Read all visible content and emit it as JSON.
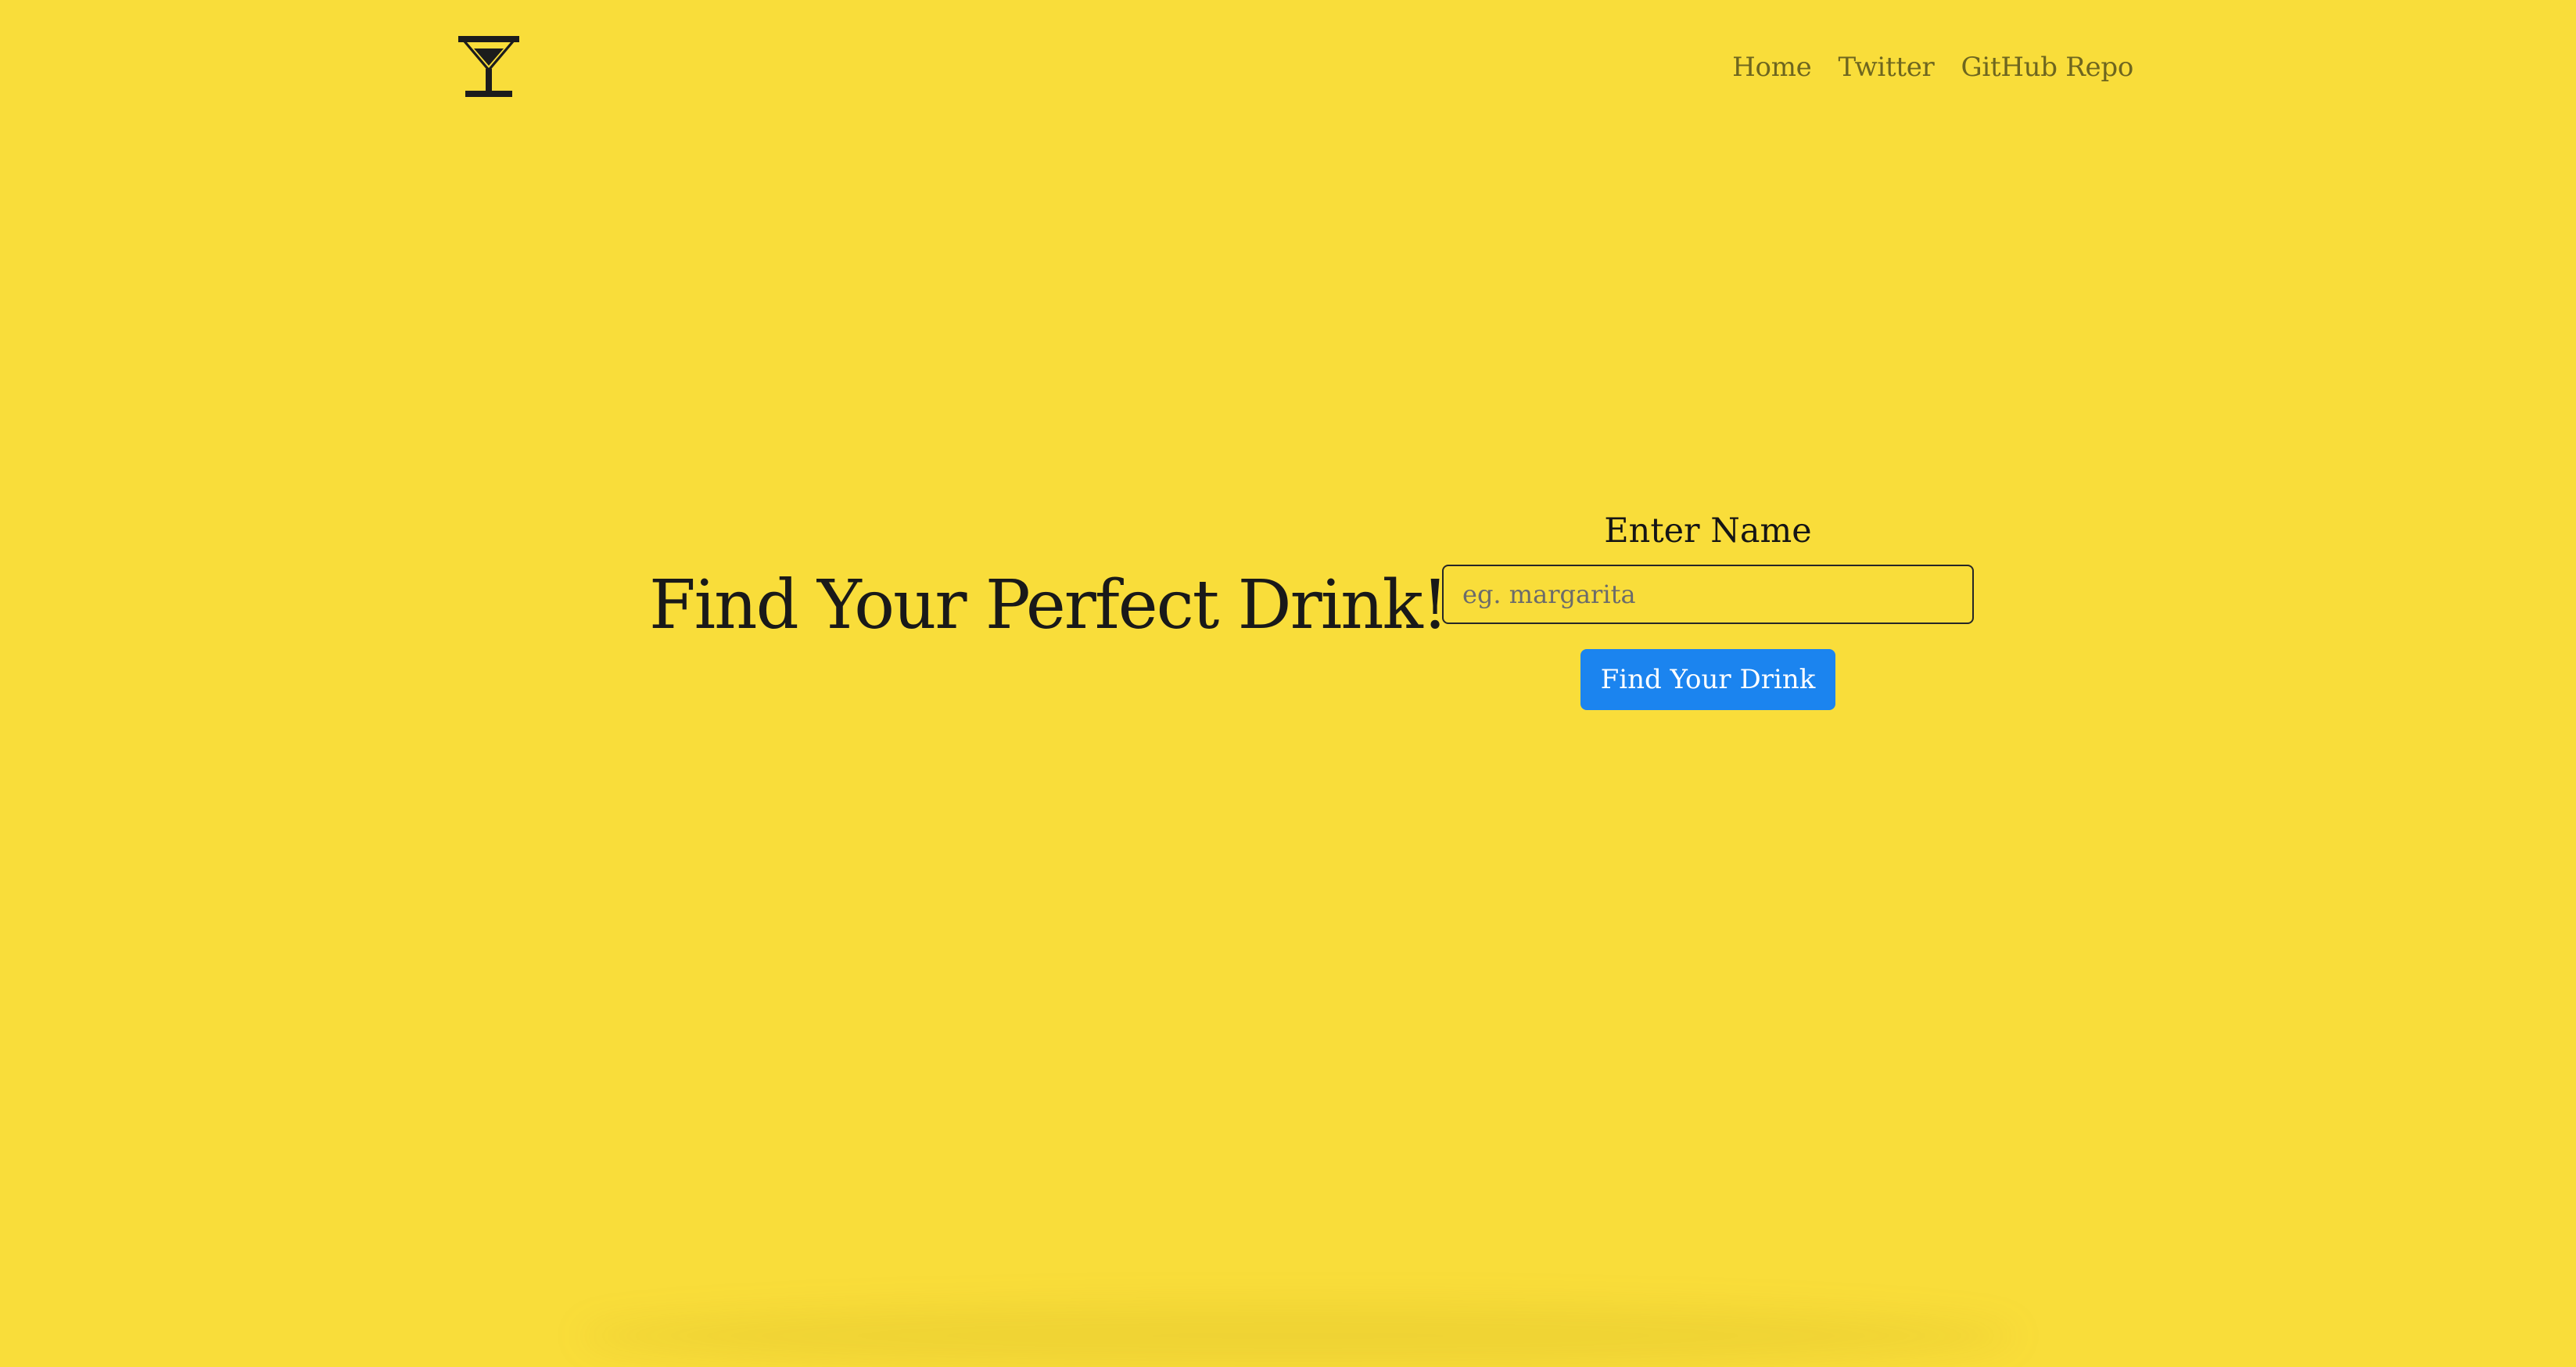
{
  "brand": {
    "logo_icon": "cocktail-glass-icon"
  },
  "nav": {
    "links": [
      {
        "label": "Home"
      },
      {
        "label": "Twitter"
      },
      {
        "label": "GitHub Repo"
      }
    ]
  },
  "hero": {
    "title": "Find Your Perfect Drink!"
  },
  "search": {
    "label": "Enter Name",
    "placeholder": "eg. margarita",
    "value": "",
    "button_label": "Find Your Drink"
  },
  "colors": {
    "background": "#f9dd3a",
    "button": "#1b84ef",
    "nav_link": "#6e661f",
    "text": "#191919"
  }
}
